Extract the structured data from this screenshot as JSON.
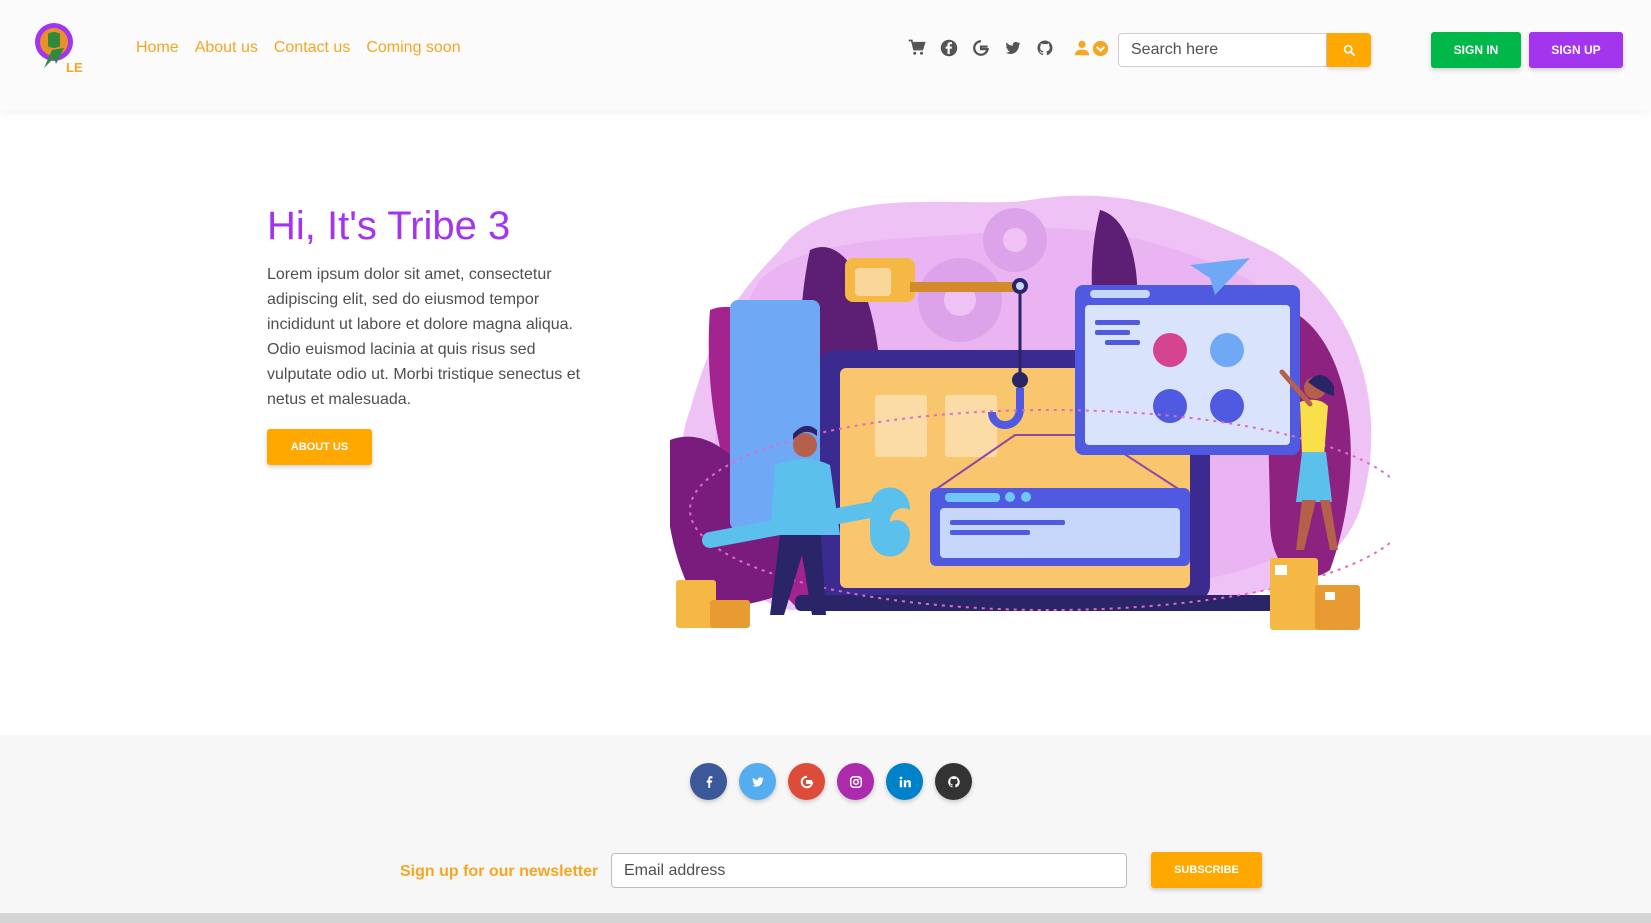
{
  "nav": {
    "logo_text": "LE",
    "links": [
      "Home",
      "About us",
      "Contact us",
      "Coming soon"
    ],
    "icons": [
      "cart-icon",
      "facebook-icon",
      "google-icon",
      "twitter-icon",
      "github-icon"
    ],
    "user_icon": "user-icon",
    "search_placeholder": "Search here",
    "signin_label": "SIGN IN",
    "signup_label": "SIGN UP"
  },
  "hero": {
    "title": "Hi, It's Tribe 3",
    "text": "Lorem ipsum dolor sit amet, consectetur adipiscing elit, sed do eiusmod tempor incididunt ut labore et dolore magna aliqua. Odio euismod lacinia at quis risus sed vulputate odio ut. Morbi tristique senectus et netus et malesuada.",
    "button_label": "ABOUT US"
  },
  "footer": {
    "social": [
      {
        "name": "facebook",
        "color": "#3b5998"
      },
      {
        "name": "twitter",
        "color": "#55acee"
      },
      {
        "name": "google",
        "color": "#dd4b39"
      },
      {
        "name": "instagram",
        "color": "#ac2bac"
      },
      {
        "name": "linkedin",
        "color": "#0082ca"
      },
      {
        "name": "github",
        "color": "#333333"
      }
    ],
    "newsletter_label": "Sign up for our newsletter",
    "email_placeholder": "Email address",
    "subscribe_label": "SUBSCRIBE"
  },
  "colors": {
    "primary": "#a335ee",
    "accent": "#ffa900",
    "success": "#00b74a"
  }
}
